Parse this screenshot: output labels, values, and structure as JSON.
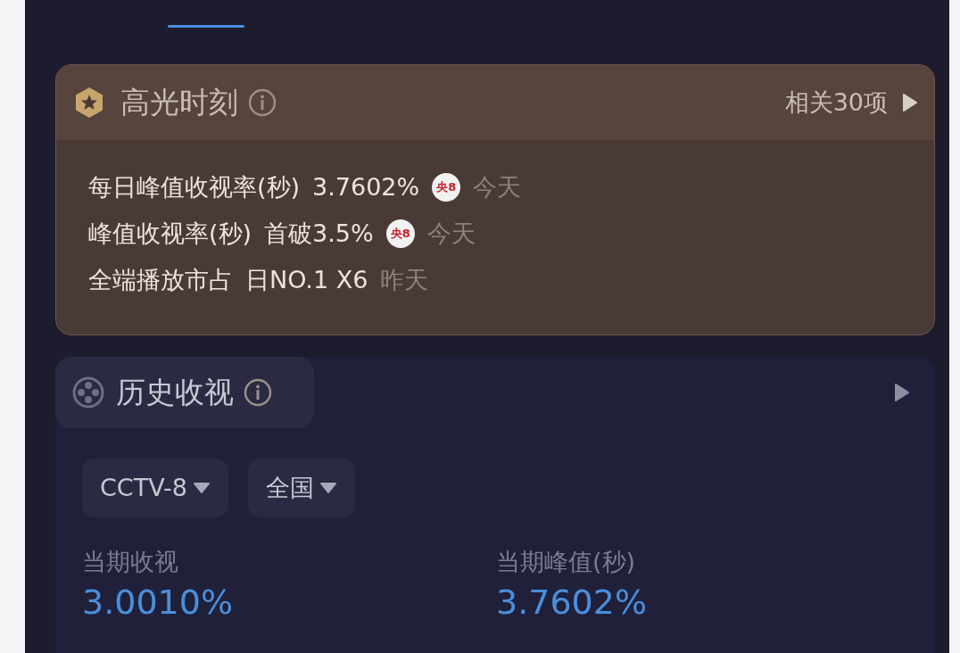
{
  "highlights": {
    "title": "高光时刻",
    "more": "相关30项",
    "items": [
      {
        "label": "每日峰值收视率(秒)",
        "value": "3.7602%",
        "badge": "央8",
        "time": "今天"
      },
      {
        "label": "峰值收视率(秒)",
        "value": "首破3.5%",
        "badge": "央8",
        "time": "今天"
      },
      {
        "label": "全端播放市占",
        "value": "日NO.1 X6",
        "time": "昨天"
      }
    ]
  },
  "history": {
    "title": "历史收视",
    "filters": [
      {
        "label": "CCTV-8"
      },
      {
        "label": "全国"
      }
    ],
    "stats": [
      {
        "label": "当期收视",
        "value": "3.0010%"
      },
      {
        "label": "当期峰值(秒)",
        "value": "3.7602%"
      }
    ]
  }
}
